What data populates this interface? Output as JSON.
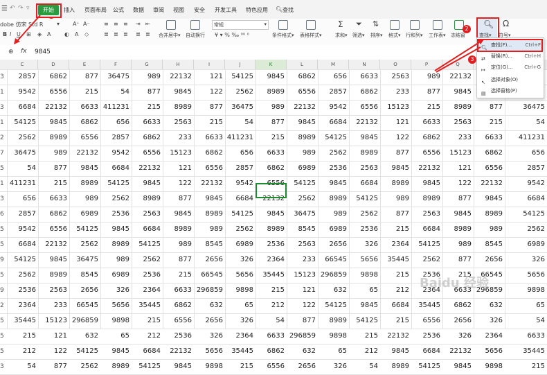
{
  "menubar": {
    "items": [
      "开始",
      "插入",
      "页面布局",
      "公式",
      "数据",
      "审阅",
      "视图",
      "安全",
      "开发工具",
      "特色应用",
      "查找"
    ]
  },
  "ribbon": {
    "font_name": "dobe 仿宋 Std R",
    "format_value": "常规",
    "merge_label": "合并居中▾",
    "wrap_label": "自动换行",
    "cond_format_label": "条件格式▾",
    "table_style_label": "表格样式▾",
    "sum_label": "求和▾",
    "filter_label": "筛选▾",
    "sort_label": "排序▾",
    "format_label": "格式▾",
    "rowcol_label": "行和列▾",
    "sheet_label": "工作表▾",
    "freeze_label": "冻结窗",
    "find_label": "查找▾",
    "symbol_label": "符号▾"
  },
  "formula_bar": {
    "fx_label": "fx",
    "value": "9845"
  },
  "columns": [
    "C",
    "D",
    "E",
    "F",
    "G",
    "H",
    "I",
    "J",
    "K",
    "L",
    "M",
    "N",
    "O",
    "P",
    "Q"
  ],
  "row_numbers": [
    "3",
    "1",
    "3",
    "1",
    "2",
    "7",
    "5",
    "1",
    "3",
    "6",
    "5",
    "5",
    "9",
    "5",
    "9",
    "2",
    "5",
    "5",
    "5",
    "3",
    "5"
  ],
  "rows": [
    [
      "2857",
      "6862",
      "877",
      "36475",
      "989",
      "22132",
      "121",
      "54125",
      "9845",
      "6862",
      "656",
      "6633",
      "2563",
      "989",
      "22132",
      "",
      ""
    ],
    [
      "9542",
      "6556",
      "215",
      "54",
      "877",
      "9845",
      "122",
      "2562",
      "8989",
      "6556",
      "2857",
      "6862",
      "233",
      "877",
      "9845",
      "",
      ""
    ],
    [
      "6684",
      "22132",
      "6633",
      "411231",
      "215",
      "8989",
      "877",
      "36475",
      "989",
      "22132",
      "9542",
      "6556",
      "15123",
      "215",
      "8989",
      "877",
      "36475"
    ],
    [
      "54125",
      "9845",
      "6862",
      "656",
      "6633",
      "2563",
      "215",
      "54",
      "877",
      "9845",
      "6684",
      "22132",
      "121",
      "6633",
      "2563",
      "215",
      "54"
    ],
    [
      "2562",
      "8989",
      "6556",
      "2857",
      "6862",
      "233",
      "6633",
      "411231",
      "215",
      "8989",
      "54125",
      "9845",
      "122",
      "6862",
      "233",
      "6633",
      "411231"
    ],
    [
      "36475",
      "989",
      "22132",
      "9542",
      "6556",
      "15123",
      "6862",
      "656",
      "6633",
      "989",
      "2562",
      "8989",
      "877",
      "6556",
      "15123",
      "6862",
      "656"
    ],
    [
      "54",
      "877",
      "9845",
      "6684",
      "22132",
      "121",
      "6556",
      "2857",
      "6862",
      "6989",
      "2536",
      "2563",
      "9845",
      "22132",
      "121",
      "6556",
      "2857"
    ],
    [
      "411231",
      "215",
      "8989",
      "54125",
      "9845",
      "122",
      "22132",
      "9542",
      "6556",
      "54125",
      "9845",
      "6684",
      "8989",
      "9845",
      "122",
      "22132",
      "9542"
    ],
    [
      "656",
      "6633",
      "989",
      "2562",
      "8989",
      "877",
      "9845",
      "6684",
      "22132",
      "2562",
      "8989",
      "54125",
      "989",
      "8989",
      "877",
      "9845",
      "6684"
    ],
    [
      "2857",
      "6862",
      "6989",
      "2536",
      "2563",
      "9845",
      "8989",
      "54125",
      "9845",
      "36475",
      "989",
      "2562",
      "877",
      "2563",
      "9845",
      "8989",
      "54125"
    ],
    [
      "9542",
      "6556",
      "54125",
      "9845",
      "6684",
      "8989",
      "989",
      "2562",
      "8989",
      "8545",
      "6989",
      "2536",
      "215",
      "6684",
      "8989",
      "989",
      "2562"
    ],
    [
      "6684",
      "22132",
      "2562",
      "8989",
      "54125",
      "989",
      "8545",
      "6989",
      "2536",
      "2563",
      "2656",
      "326",
      "2364",
      "54125",
      "989",
      "8545",
      "6989"
    ],
    [
      "54125",
      "9845",
      "36475",
      "989",
      "2562",
      "877",
      "2656",
      "326",
      "2364",
      "233",
      "66545",
      "5656",
      "35445",
      "2562",
      "877",
      "2656",
      "326"
    ],
    [
      "2562",
      "8989",
      "8545",
      "6989",
      "2536",
      "215",
      "66545",
      "5656",
      "35445",
      "15123",
      "296859",
      "9898",
      "215",
      "2536",
      "215",
      "66545",
      "5656"
    ],
    [
      "2536",
      "2563",
      "2656",
      "326",
      "2364",
      "6633",
      "296859",
      "9898",
      "215",
      "121",
      "632",
      "65",
      "212",
      "2364",
      "6633",
      "296859",
      "9898"
    ],
    [
      "2364",
      "233",
      "66545",
      "5656",
      "35445",
      "6862",
      "632",
      "65",
      "212",
      "122",
      "54125",
      "9845",
      "6684",
      "35445",
      "6862",
      "632",
      "65"
    ],
    [
      "35445",
      "15123",
      "296859",
      "9898",
      "215",
      "6556",
      "2656",
      "326",
      "54",
      "877",
      "8989",
      "54125",
      "215",
      "6556",
      "2656",
      "326",
      "54"
    ],
    [
      "215",
      "121",
      "632",
      "65",
      "212",
      "2536",
      "326",
      "2364",
      "6633",
      "296859",
      "9898",
      "215",
      "22132",
      "2536",
      "326",
      "2364",
      "6633"
    ],
    [
      "212",
      "122",
      "54125",
      "9845",
      "6684",
      "22132",
      "5656",
      "35445",
      "6862",
      "632",
      "65",
      "212",
      "9845",
      "6684",
      "22132",
      "5656",
      "35445"
    ],
    [
      "54",
      "877",
      "2562",
      "8989",
      "54125",
      "9845",
      "9898",
      "215",
      "6556",
      "2656",
      "326",
      "54",
      "8989",
      "54125",
      "9845",
      "9898",
      "215"
    ]
  ],
  "dropdown": {
    "items": [
      {
        "label": "查找(F)...",
        "shortcut": "Ctrl+F"
      },
      {
        "label": "替换(R)...",
        "shortcut": "Ctrl+H"
      },
      {
        "label": "定位(G)...",
        "shortcut": "Ctrl+G"
      },
      {
        "label": "选择对象(O)",
        "shortcut": ""
      },
      {
        "label": "选择窗格(P)",
        "shortcut": ""
      }
    ]
  },
  "annotations": [
    "1",
    "2",
    "3"
  ],
  "watermark": "Baidu 经验"
}
